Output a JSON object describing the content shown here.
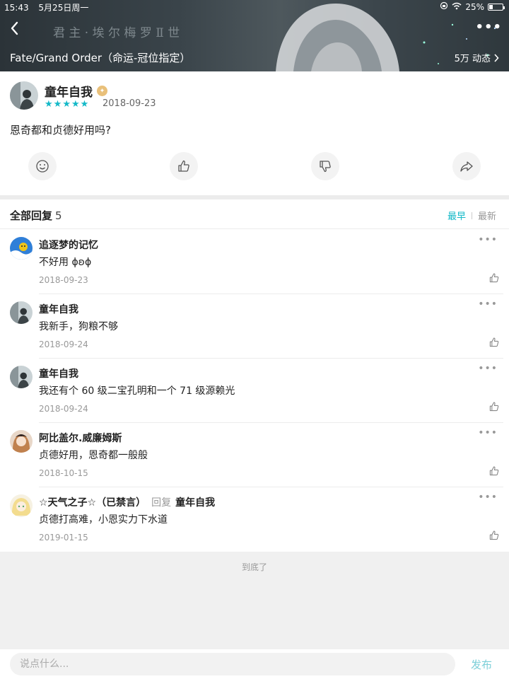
{
  "status_bar": {
    "time": "15:43",
    "date": "5月25日周一",
    "battery": "25%"
  },
  "header": {
    "banner_text": "君 主 · 埃 尔 梅 罗 Ⅱ 世",
    "game_title": "Fate/Grand Order（命运-冠位指定）",
    "follow_count": "5万 动态",
    "back_icon": "chevron-left-icon",
    "more_icon": "more-dots-icon"
  },
  "post": {
    "author": "童年自我",
    "badge_icon": "verified-badge-icon",
    "rating": 5,
    "date": "2018-09-23",
    "text": "恩奇都和贞德好用吗?",
    "actions": [
      "emoji-icon",
      "thumbs-up-icon",
      "thumbs-down-icon",
      "share-icon"
    ]
  },
  "replies_section": {
    "title": "全部回复",
    "count": "5",
    "sort_earliest": "最早",
    "sort_latest": "最新",
    "items": [
      {
        "name": "追逐梦的记忆",
        "text": "不好用 ɸʚɸ",
        "date": "2018-09-23"
      },
      {
        "name": "童年自我",
        "text": "我新手，狗粮不够",
        "date": "2018-09-24"
      },
      {
        "name": "童年自我",
        "text": "我还有个 60 级二宝孔明和一个 71 级源赖光",
        "date": "2018-09-24"
      },
      {
        "name": "阿比盖尔.威廉姆斯",
        "text": "贞德好用，恩奇都一般般",
        "date": "2018-10-15"
      },
      {
        "name": "☆天气之子☆（已禁言）",
        "reply_label": "回复",
        "reply_target": "童年自我",
        "text": "贞德打高难，小恩实力下水道",
        "date": "2019-01-15"
      }
    ]
  },
  "end_text": "到底了",
  "comment_bar": {
    "placeholder": "说点什么...",
    "publish_label": "发布"
  },
  "colors": {
    "accent": "#14b9c8",
    "publish": "#7ccfd8"
  }
}
